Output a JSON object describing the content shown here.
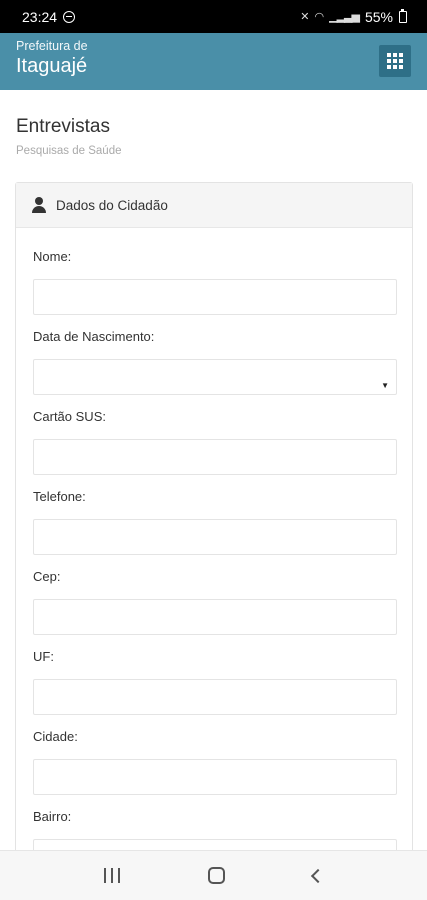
{
  "status_bar": {
    "time": "23:24",
    "battery": "55%"
  },
  "app_header": {
    "subtitle": "Prefeitura de",
    "title": "Itaguajé"
  },
  "page": {
    "title": "Entrevistas",
    "subtitle": "Pesquisas de Saúde"
  },
  "panel": {
    "heading": "Dados do Cidadão"
  },
  "form": {
    "fields": [
      {
        "label": "Nome:",
        "value": "",
        "type": "text"
      },
      {
        "label": "Data de Nascimento:",
        "value": "",
        "type": "select"
      },
      {
        "label": "Cartão SUS:",
        "value": "",
        "type": "text"
      },
      {
        "label": "Telefone:",
        "value": "",
        "type": "text"
      },
      {
        "label": "Cep:",
        "value": "",
        "type": "text"
      },
      {
        "label": "UF:",
        "value": "",
        "type": "text"
      },
      {
        "label": "Cidade:",
        "value": "",
        "type": "text"
      },
      {
        "label": "Bairro:",
        "value": "",
        "type": "text"
      }
    ]
  },
  "colors": {
    "header_bg": "#4a8fa8",
    "header_button_bg": "#2e6f87"
  }
}
